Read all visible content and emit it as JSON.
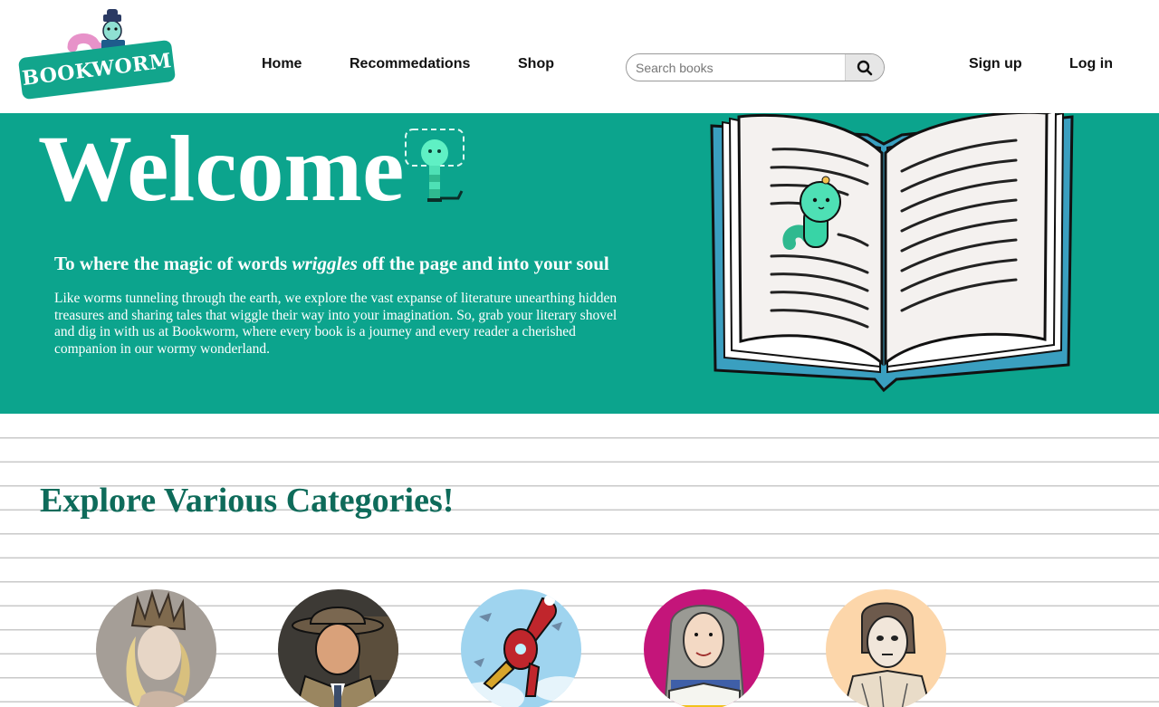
{
  "header": {
    "logo_text": "BOOKWORM",
    "nav": {
      "home": "Home",
      "recommendations": "Recommedations",
      "shop": "Shop",
      "signup": "Sign up",
      "login": "Log in"
    },
    "search": {
      "placeholder": "Search books",
      "value": ""
    }
  },
  "hero": {
    "title": "Welcome",
    "subtitle_before": "To where the magic of words ",
    "subtitle_emphasis": "wriggles",
    "subtitle_after": " off the page and into your soul",
    "body": "Like worms tunneling through the earth, we explore the vast expanse of literature unearthing hidden treasures and sharing tales that wiggle their way into your imagination. So, grab your literary shovel and dig in with us at Bookworm, where every book is a journey and every reader a cherished companion in our wormy wonderland."
  },
  "categories": {
    "title": "Explore Various Categories!"
  },
  "colors": {
    "brand_teal": "#0ca48d",
    "heading_green": "#0e6b5a"
  },
  "icons": [
    "search-icon",
    "bookworm-logo-icon",
    "pixel-worm-icon",
    "open-book-illustration"
  ]
}
